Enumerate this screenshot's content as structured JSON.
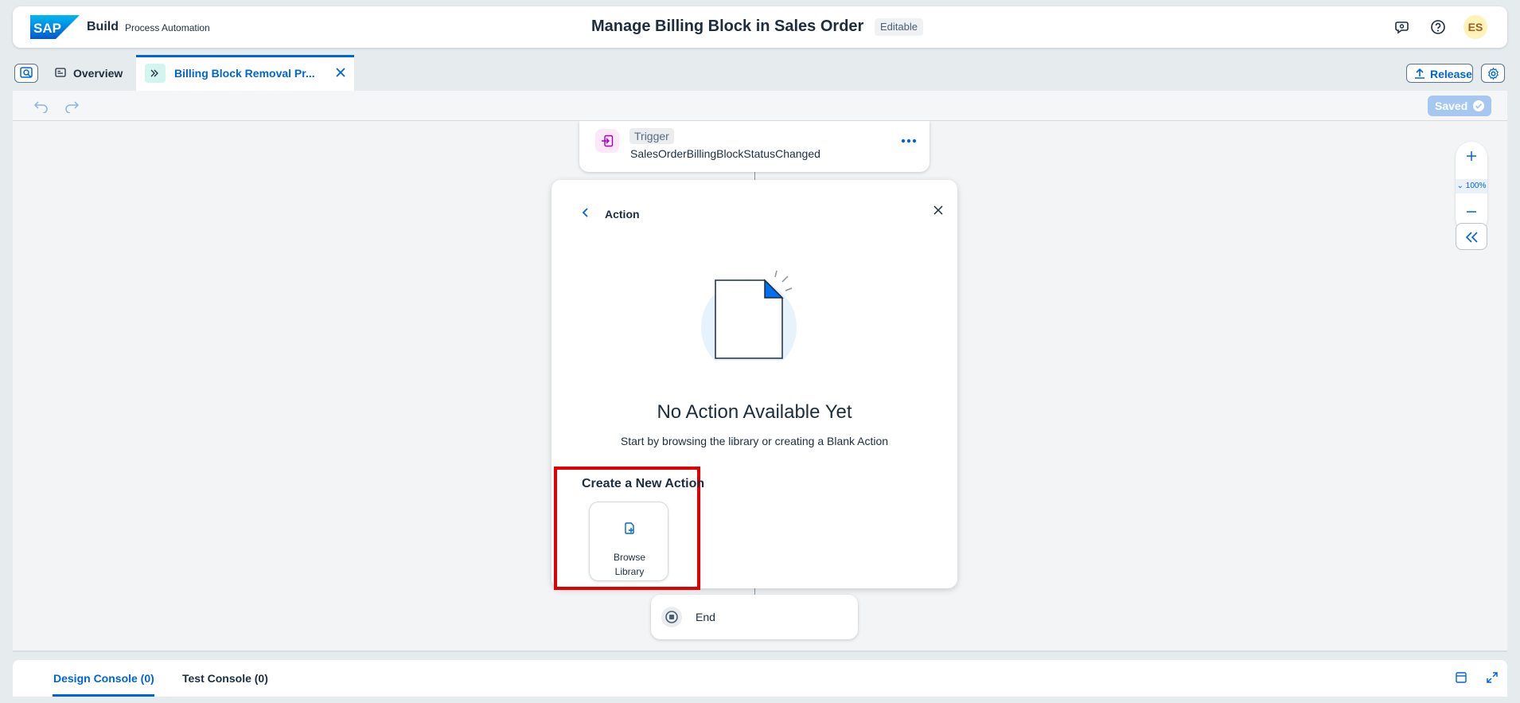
{
  "shell": {
    "logo": "SAP",
    "product": "Build",
    "subproduct": "Process Automation",
    "title": "Manage Billing Block in Sales Order",
    "badge": "Editable",
    "icons": [
      "feedback-icon",
      "help-icon"
    ],
    "avatar_initials": "ES"
  },
  "tabs": {
    "overview_label": "Overview",
    "active_label": "Billing Block Removal Pr...",
    "release_label": "Release"
  },
  "toolbar": {
    "saved_label": "Saved"
  },
  "trigger": {
    "tag": "Trigger",
    "event": "SalesOrderBillingBlockStatusChanged"
  },
  "action_panel": {
    "title": "Action",
    "empty_title": "No Action Available Yet",
    "empty_desc": "Start by browsing the library or creating a Blank Action",
    "create_title": "Create a New Action",
    "browse_line1": "Browse",
    "browse_line2": "Library"
  },
  "end_node": {
    "label": "End"
  },
  "zoom": {
    "level": "100%"
  },
  "console": {
    "design_tab": "Design Console (0)",
    "test_tab": "Test Console (0)"
  },
  "colors": {
    "accent": "#0064d9",
    "highlight_border": "#e00000",
    "saved_button": "#a6c8f0",
    "avatar_bg": "#fff3b8"
  }
}
